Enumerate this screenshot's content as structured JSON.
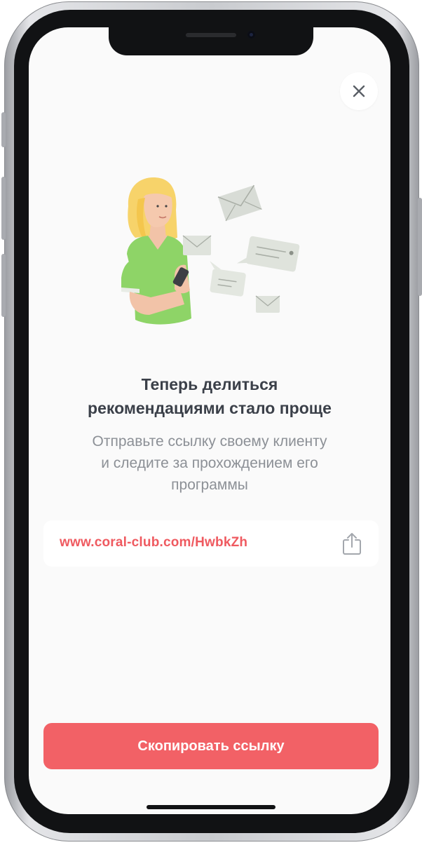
{
  "header": {
    "close_icon": "close-icon"
  },
  "main": {
    "illustration": "woman-sharing-messages-illustration",
    "title_line1": "Теперь делиться",
    "title_line2": "рекомендациями стало проще",
    "subtitle_line1": "Отправьте ссылку своему клиенту",
    "subtitle_line2": "и следите за прохождением его",
    "subtitle_line3": "программы"
  },
  "link_card": {
    "url": "www.coral-club.com/HwbkZh",
    "share_icon": "share-icon"
  },
  "footer": {
    "copy_button_label": "Скопировать ссылку"
  },
  "colors": {
    "accent": "#f26166",
    "link_text": "#ef5a60",
    "title_text": "#3b4049",
    "subtitle_text": "#8c9096",
    "screen_background": "#fafafa"
  }
}
